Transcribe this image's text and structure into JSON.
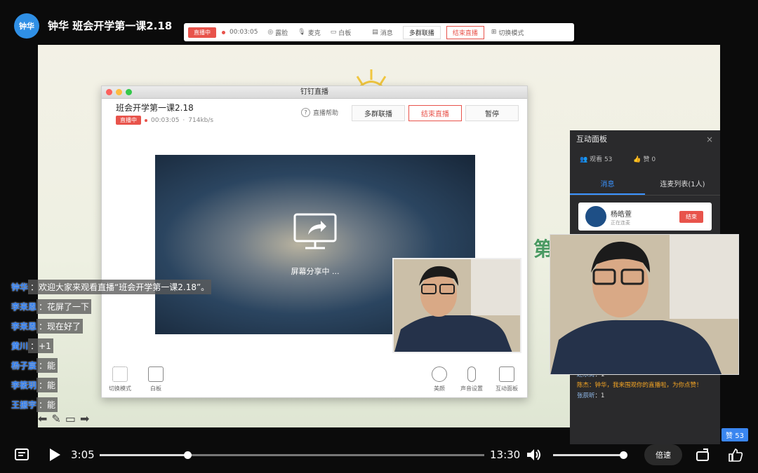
{
  "header": {
    "avatar": "钟华",
    "title": "钟华 班会开学第一课2.18"
  },
  "topbar": {
    "live": "直播中",
    "time": "00:03:05",
    "items": [
      "露脸",
      "麦克",
      "白板",
      "消息"
    ],
    "multi_group": "多群联播",
    "end_live": "结束直播",
    "switch_mode": "切换模式"
  },
  "window": {
    "bar_title": "钉钉直播",
    "title": "班会开学第一课2.18",
    "live": "直播中",
    "time": "00:03:05",
    "rate": "714kb/s",
    "help": "直播帮助",
    "multi_group": "多群联播",
    "end_live": "结束直播",
    "pause": "暂停",
    "sharing": "屏幕分享中 ...",
    "tools_left": [
      "切换模式",
      "白板"
    ],
    "tools_right": [
      "美颜",
      "声音设置",
      "互动面板"
    ]
  },
  "stage": {
    "side_text": "第"
  },
  "panel": {
    "title": "互动面板",
    "close": "×",
    "viewers": "观看 53",
    "likes": "赞 0",
    "tab_msg": "消息",
    "tab_mic": "连麦列表(1人)",
    "card_name": "杨皓萱",
    "card_status": "正在连麦",
    "card_end": "结束",
    "messages": [
      {
        "user": "赵乐涛",
        "text": "：1"
      },
      {
        "user": "陈杰",
        "text": "：钟华，我来围观你的直播啦，为你点赞！"
      },
      {
        "user": "张辰昕",
        "text": "：1"
      }
    ]
  },
  "chat": [
    {
      "name": "钟华",
      "msg": "欢迎大家来观看直播“班会开学第一课2.18”。"
    },
    {
      "name": "李来恩",
      "msg": "花屏了一下"
    },
    {
      "name": "李来恩",
      "msg": "现在好了"
    },
    {
      "name": "黄川",
      "msg": "+1"
    },
    {
      "name": "杨子宸",
      "msg": "能"
    },
    {
      "name": "李筱玥",
      "msg": "能"
    },
    {
      "name": "王振宇",
      "msg": "能"
    }
  ],
  "like_badge": "赞 53",
  "player": {
    "current": "3:05",
    "total": "13:30",
    "speed": "倍速",
    "progress": 0.228,
    "volume": 1.0
  }
}
